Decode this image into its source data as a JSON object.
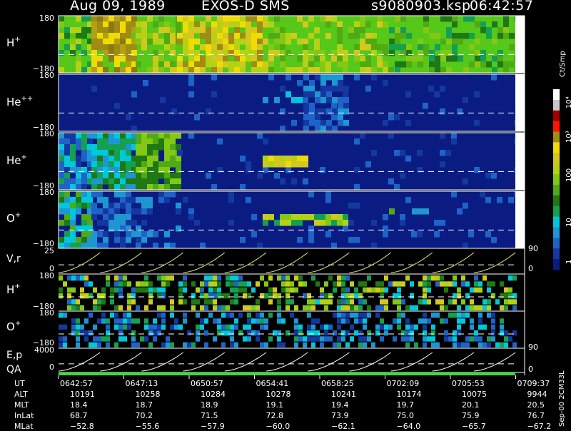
{
  "title": {
    "date": "Aug 09, 1989",
    "mission": "EXOS-D SMS",
    "file": "s9080903.ksp",
    "time": "06:42:57"
  },
  "spectrogram_panels": [
    {
      "label": "H",
      "charge": "+",
      "ymax": "180",
      "ymin": "−180",
      "bg": "#55c81a"
    },
    {
      "label": "He",
      "charge": "++",
      "ymax": "180",
      "ymin": "−180",
      "bg": "#0a1c82"
    },
    {
      "label": "He",
      "charge": "+",
      "ymax": "180",
      "ymin": "−180",
      "bg": "#0a1c82"
    },
    {
      "label": "O",
      "charge": "+",
      "ymax": "180",
      "ymin": "−180",
      "bg": "#0a1c82"
    }
  ],
  "line_panels": {
    "v": {
      "label": "V,r",
      "ymax": "25",
      "ymin": "0",
      "rmax": "90",
      "rmin": "0"
    },
    "e": {
      "label": "E,p",
      "label2": "QA",
      "ymax": "4000",
      "ymin": "0",
      "rmax": "90",
      "rmin": "0"
    }
  },
  "small_panels": [
    {
      "label": "H",
      "charge": "+",
      "ymax": "180",
      "ymin": "−180"
    },
    {
      "label": "O",
      "charge": "+",
      "ymax": "180",
      "ymin": "−180"
    }
  ],
  "colorbar": {
    "unit": "Ct/Smp",
    "ticks": [
      "10⁴",
      "10³",
      "100",
      "10",
      "1"
    ]
  },
  "ephemeris": {
    "row_labels": [
      "UT",
      "ALT",
      "MLT",
      "InLat",
      "MLat"
    ],
    "columns": [
      {
        "UT": "0642:57",
        "ALT": "10191",
        "MLT": "18.4",
        "InLat": "68.7",
        "MLat": "−52.8"
      },
      {
        "UT": "0647:13",
        "ALT": "10258",
        "MLT": "18.7",
        "InLat": "70.2",
        "MLat": "−55.6"
      },
      {
        "UT": "0650:57",
        "ALT": "10284",
        "MLT": "18.9",
        "InLat": "71.5",
        "MLat": "−57.9"
      },
      {
        "UT": "0654:41",
        "ALT": "10278",
        "MLT": "19.1",
        "InLat": "72.8",
        "MLat": "−60.0"
      },
      {
        "UT": "0658:25",
        "ALT": "10241",
        "MLT": "19.4",
        "InLat": "73.9",
        "MLat": "−62.1"
      },
      {
        "UT": "0702:09",
        "ALT": "10174",
        "MLT": "19.7",
        "InLat": "75.0",
        "MLat": "−64.0"
      },
      {
        "UT": "0705:53",
        "ALT": "10075",
        "MLT": "20.1",
        "InLat": "75.9",
        "MLat": "−65.7"
      },
      {
        "UT": "0709:37",
        "ALT": "9944",
        "MLT": "20.5",
        "InLat": "76.7",
        "MLat": "−67.2"
      }
    ]
  },
  "footer_id": "Sep-00 2CM33L",
  "chart_data": {
    "type": "heatmap",
    "title": "Aug 09, 1989   EXOS-D SMS   s9080903.ksp   06:42:57",
    "x": [
      "0642:57",
      "0647:13",
      "0650:57",
      "0654:41",
      "0658:25",
      "0702:09",
      "0705:53",
      "0709:37"
    ],
    "xlabel": "UT",
    "series": [
      {
        "name": "H+",
        "ylim": [
          -180,
          180
        ]
      },
      {
        "name": "He++",
        "ylim": [
          -180,
          180
        ]
      },
      {
        "name": "He+",
        "ylim": [
          -180,
          180
        ]
      },
      {
        "name": "O+",
        "ylim": [
          -180,
          180
        ]
      }
    ],
    "color_scale": {
      "unit": "Ct/Smp",
      "range": [
        1,
        10000
      ],
      "log": true
    },
    "line_panels": [
      {
        "name": "V,r",
        "ylim": [
          0,
          25
        ],
        "right_ylim": [
          0,
          90
        ]
      },
      {
        "name": "E,p",
        "ylim": [
          0,
          4000
        ],
        "right_ylim": [
          0,
          90
        ]
      }
    ]
  }
}
